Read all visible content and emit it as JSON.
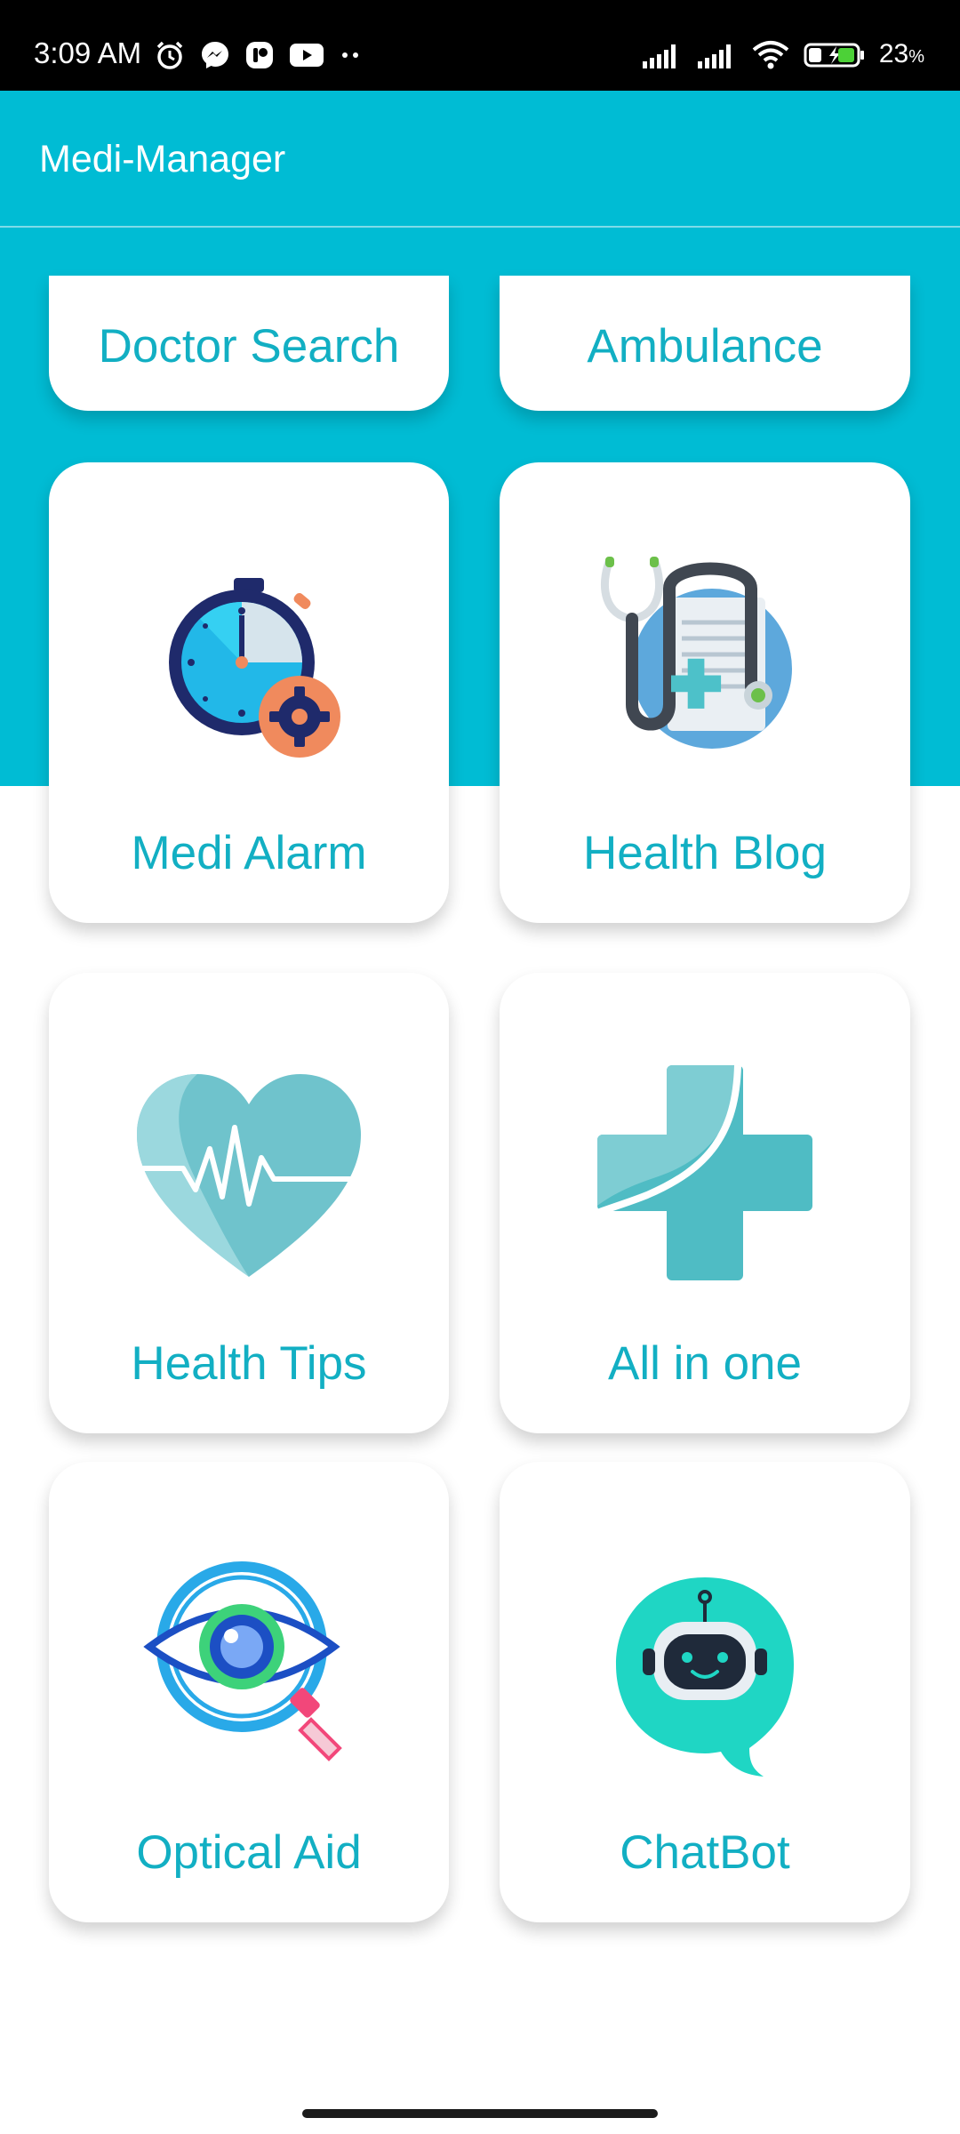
{
  "status_bar": {
    "time": "3:09 AM",
    "battery_percent": "23",
    "battery_suffix": "%",
    "left_icons": [
      "alarm-icon",
      "messenger-icon",
      "app-icon",
      "youtube-icon",
      "more-dots-icon"
    ],
    "right_icons": [
      "signal-icon",
      "signal-icon",
      "wifi-icon",
      "battery-charging-icon"
    ]
  },
  "app_bar": {
    "title": "Medi-Manager"
  },
  "colors": {
    "primary": "#00BCD4",
    "label": "#12AFC3",
    "card": "#FFFFFF"
  },
  "cards": [
    {
      "label": "Doctor Search",
      "icon": null
    },
    {
      "label": "Ambulance",
      "icon": null
    },
    {
      "label": "Medi Alarm",
      "icon": "stopwatch-gear-icon"
    },
    {
      "label": "Health Blog",
      "icon": "stethoscope-document-icon"
    },
    {
      "label": "Health Tips",
      "icon": "heart-pulse-icon"
    },
    {
      "label": "All in one",
      "icon": "medical-cross-icon"
    },
    {
      "label": "Optical Aid",
      "icon": "eye-magnifier-icon"
    },
    {
      "label": "ChatBot",
      "icon": "robot-chat-icon"
    }
  ]
}
